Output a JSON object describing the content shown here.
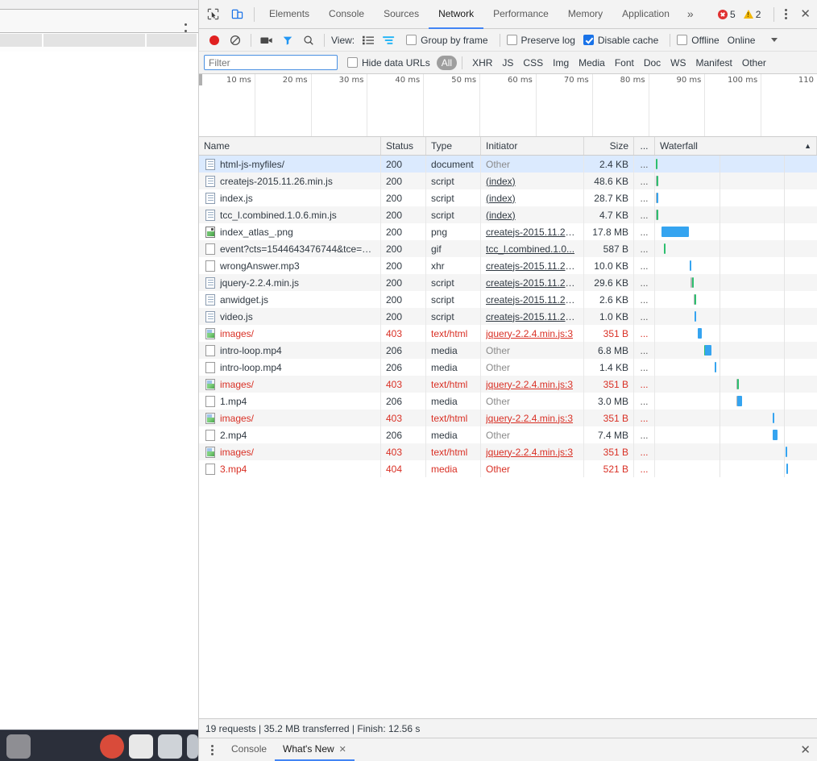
{
  "background_window": {
    "kebab_icon": "kebab-menu-icon",
    "dock_present": true
  },
  "devtools": {
    "tabbar": {
      "inspect_icon": "cursor-inspect-icon",
      "device_toolbar_icon": "device-toolbar-icon",
      "tabs": [
        {
          "label": "Elements",
          "active": false
        },
        {
          "label": "Console",
          "active": false
        },
        {
          "label": "Sources",
          "active": false
        },
        {
          "label": "Network",
          "active": true
        },
        {
          "label": "Performance",
          "active": false
        },
        {
          "label": "Memory",
          "active": false
        },
        {
          "label": "Application",
          "active": false
        }
      ],
      "more_tabs_label": "»",
      "error_count": "5",
      "warning_count": "2",
      "settings_icon": "kebab-menu-icon",
      "close_label": "✕"
    },
    "controlbar": {
      "record_icon": "record-icon",
      "clear_icon": "clear-icon",
      "capture_screenshots_icon": "camera-icon",
      "filter_icon": "funnel-icon",
      "search_icon": "search-icon",
      "view_label": "View:",
      "list_view_icon": "list-view-icon",
      "waterfall_view_icon": "waterfall-view-icon",
      "group_by_frame": {
        "label": "Group by frame",
        "checked": false
      },
      "preserve_log": {
        "label": "Preserve log",
        "checked": false
      },
      "disable_cache": {
        "label": "Disable cache",
        "checked": true
      },
      "offline": {
        "label": "Offline",
        "checked": false
      },
      "throttling_value": "Online",
      "throttling_caret_icon": "chevron-down-icon"
    },
    "filterbar": {
      "filter_placeholder": "Filter",
      "filter_value": "",
      "hide_data_urls": {
        "label": "Hide data URLs",
        "checked": false
      },
      "types": [
        {
          "label": "All",
          "active": true
        },
        {
          "label": "XHR",
          "active": false
        },
        {
          "label": "JS",
          "active": false
        },
        {
          "label": "CSS",
          "active": false
        },
        {
          "label": "Img",
          "active": false
        },
        {
          "label": "Media",
          "active": false
        },
        {
          "label": "Font",
          "active": false
        },
        {
          "label": "Doc",
          "active": false
        },
        {
          "label": "WS",
          "active": false
        },
        {
          "label": "Manifest",
          "active": false
        },
        {
          "label": "Other",
          "active": false
        }
      ]
    },
    "overview_ruler": {
      "ticks": [
        "10 ms",
        "20 ms",
        "30 ms",
        "40 ms",
        "50 ms",
        "60 ms",
        "70 ms",
        "80 ms",
        "90 ms",
        "100 ms",
        "110 "
      ]
    },
    "table": {
      "columns": [
        {
          "label": "Name"
        },
        {
          "label": "Status"
        },
        {
          "label": "Type"
        },
        {
          "label": "Initiator"
        },
        {
          "label": "Size"
        },
        {
          "label": "..."
        },
        {
          "label": "Waterfall"
        }
      ],
      "sort_indicator": "▲",
      "rows": [
        {
          "icon": "document-file-icon",
          "name": "html-js-myfiles/",
          "status": "200",
          "type": "document",
          "initiator": "Other",
          "initiator_link": false,
          "size": "2.4 KB",
          "dots": "...",
          "error": false,
          "selected": true,
          "bars": [
            {
              "kind": "wait",
              "start": 0.5,
              "width": 0.6
            }
          ]
        },
        {
          "icon": "document-file-icon",
          "name": "createjs-2015.11.26.min.js",
          "status": "200",
          "type": "script",
          "initiator": "(index)",
          "initiator_link": true,
          "size": "48.6 KB",
          "dots": "...",
          "error": false,
          "selected": false,
          "bars": [
            {
              "kind": "queue",
              "start": 1.4,
              "width": 0.9
            },
            {
              "kind": "wait",
              "start": 2.2,
              "width": 0.8
            }
          ]
        },
        {
          "icon": "document-file-icon",
          "name": "index.js",
          "status": "200",
          "type": "script",
          "initiator": "(index)",
          "initiator_link": true,
          "size": "28.7 KB",
          "dots": "...",
          "error": false,
          "selected": false,
          "bars": [
            {
              "kind": "queue",
              "start": 1.2,
              "width": 1.0
            },
            {
              "kind": "dl",
              "start": 2.2,
              "width": 0.9
            }
          ]
        },
        {
          "icon": "document-file-icon",
          "name": "tcc_l.combined.1.0.6.min.js",
          "status": "200",
          "type": "script",
          "initiator": "(index)",
          "initiator_link": true,
          "size": "4.7 KB",
          "dots": "...",
          "error": false,
          "selected": false,
          "bars": [
            {
              "kind": "queue",
              "start": 1.3,
              "width": 0.9
            },
            {
              "kind": "wait",
              "start": 2.2,
              "width": 0.9
            }
          ]
        },
        {
          "icon": "image-file-icon",
          "name": "index_atlas_.png",
          "status": "200",
          "type": "png",
          "initiator": "createjs-2015.11.26...",
          "initiator_link": true,
          "size": "17.8 MB",
          "dots": "...",
          "error": false,
          "selected": false,
          "bars": [
            {
              "kind": "dl",
              "start": 8.5,
              "width": 34.0
            }
          ]
        },
        {
          "icon": "blank-file-icon",
          "name": "event?cts=1544643476744&tce=1…",
          "status": "200",
          "type": "gif",
          "initiator": "tcc_l.combined.1.0...",
          "initiator_link": true,
          "size": "587 B",
          "dots": "...",
          "error": false,
          "selected": false,
          "bars": [
            {
              "kind": "wait",
              "start": 11.0,
              "width": 0.8
            }
          ]
        },
        {
          "icon": "blank-file-icon",
          "name": "wrongAnswer.mp3",
          "status": "200",
          "type": "xhr",
          "initiator": "createjs-2015.11.26...",
          "initiator_link": true,
          "size": "10.0 KB",
          "dots": "...",
          "error": false,
          "selected": false,
          "bars": [
            {
              "kind": "dl",
              "start": 43.0,
              "width": 1.0
            }
          ]
        },
        {
          "icon": "document-file-icon",
          "name": "jquery-2.2.4.min.js",
          "status": "200",
          "type": "script",
          "initiator": "createjs-2015.11.26...",
          "initiator_link": true,
          "size": "29.6 KB",
          "dots": "...",
          "error": false,
          "selected": false,
          "bars": [
            {
              "kind": "queue",
              "start": 44.5,
              "width": 1.3
            },
            {
              "kind": "wait",
              "start": 45.8,
              "width": 1.0
            }
          ]
        },
        {
          "icon": "document-file-icon",
          "name": "anwidget.js",
          "status": "200",
          "type": "script",
          "initiator": "createjs-2015.11.26...",
          "initiator_link": true,
          "size": "2.6 KB",
          "dots": "...",
          "error": false,
          "selected": false,
          "bars": [
            {
              "kind": "queue",
              "start": 48.5,
              "width": 0.7
            },
            {
              "kind": "wait",
              "start": 49.0,
              "width": 1.0
            }
          ]
        },
        {
          "icon": "document-file-icon",
          "name": "video.js",
          "status": "200",
          "type": "script",
          "initiator": "createjs-2015.11.26...",
          "initiator_link": true,
          "size": "1.0 KB",
          "dots": "...",
          "error": false,
          "selected": false,
          "bars": [
            {
              "kind": "dl",
              "start": 49.5,
              "width": 0.9
            }
          ]
        },
        {
          "icon": "image-error-icon",
          "name": "images/",
          "status": "403",
          "type": "text/html",
          "initiator": "jquery-2.2.4.min.js:3",
          "initiator_link": true,
          "size": "351 B",
          "dots": "...",
          "error": true,
          "selected": false,
          "bars": [
            {
              "kind": "dl",
              "start": 53.5,
              "width": 5.0
            }
          ]
        },
        {
          "icon": "blank-file-icon",
          "name": "intro-loop.mp4",
          "status": "206",
          "type": "media",
          "initiator": "Other",
          "initiator_link": false,
          "size": "6.8 MB",
          "dots": "...",
          "error": false,
          "selected": false,
          "bars": [
            {
              "kind": "wait",
              "start": 61.5,
              "width": 0.8
            },
            {
              "kind": "dl",
              "start": 62.3,
              "width": 8.0
            }
          ]
        },
        {
          "icon": "blank-file-icon",
          "name": "intro-loop.mp4",
          "status": "206",
          "type": "media",
          "initiator": "Other",
          "initiator_link": false,
          "size": "1.4 KB",
          "dots": "...",
          "error": false,
          "selected": false,
          "bars": [
            {
              "kind": "queue",
              "start": 74.0,
              "width": 0.7
            },
            {
              "kind": "dl",
              "start": 74.5,
              "width": 1.0
            }
          ]
        },
        {
          "icon": "image-error-icon",
          "name": "images/",
          "status": "403",
          "type": "text/html",
          "initiator": "jquery-2.2.4.min.js:3",
          "initiator_link": true,
          "size": "351 B",
          "dots": "...",
          "error": true,
          "selected": false,
          "bars": [
            {
              "kind": "queue",
              "start": 102.0,
              "width": 0.7
            },
            {
              "kind": "wait",
              "start": 102.5,
              "width": 0.8
            }
          ]
        },
        {
          "icon": "blank-file-icon",
          "name": "1.mp4",
          "status": "206",
          "type": "media",
          "initiator": "Other",
          "initiator_link": false,
          "size": "3.0 MB",
          "dots": "...",
          "error": false,
          "selected": false,
          "bars": [
            {
              "kind": "queue",
              "start": 102.0,
              "width": 0.8
            },
            {
              "kind": "dl",
              "start": 103.0,
              "width": 5.5
            }
          ]
        },
        {
          "icon": "image-error-icon",
          "name": "images/",
          "status": "403",
          "type": "text/html",
          "initiator": "jquery-2.2.4.min.js:3",
          "initiator_link": true,
          "size": "351 B",
          "dots": "...",
          "error": true,
          "selected": false,
          "bars": [
            {
              "kind": "dl",
              "start": 147.0,
              "width": 0.9
            }
          ]
        },
        {
          "icon": "blank-file-icon",
          "name": "2.mp4",
          "status": "206",
          "type": "media",
          "initiator": "Other",
          "initiator_link": false,
          "size": "7.4 MB",
          "dots": "...",
          "error": false,
          "selected": false,
          "bars": [
            {
              "kind": "dl",
              "start": 146.5,
              "width": 6.0
            }
          ]
        },
        {
          "icon": "image-error-icon",
          "name": "images/",
          "status": "403",
          "type": "text/html",
          "initiator": "jquery-2.2.4.min.js:3",
          "initiator_link": true,
          "size": "351 B",
          "dots": "...",
          "error": true,
          "selected": false,
          "bars": [
            {
              "kind": "dl",
              "start": 163.0,
              "width": 0.9
            }
          ]
        },
        {
          "icon": "blank-file-icon",
          "name": "3.mp4",
          "status": "404",
          "type": "media",
          "initiator": "Other",
          "initiator_link": false,
          "size": "521 B",
          "dots": "...",
          "error": true,
          "selected": false,
          "bars": [
            {
              "kind": "dl",
              "start": 163.5,
              "width": 0.9
            }
          ]
        }
      ]
    },
    "statusbar": {
      "text": "19 requests | 35.2 MB transferred | Finish: 12.56 s"
    },
    "drawer": {
      "menu_icon": "kebab-menu-icon",
      "tabs": [
        {
          "label": "Console",
          "active": false,
          "closable": false
        },
        {
          "label": "What's New",
          "active": true,
          "closable": true
        }
      ],
      "close_label": "✕"
    }
  },
  "colors": {
    "accent": "#4285f4",
    "error": "#d93025",
    "warning": "#f2b705",
    "selected_row": "#dbeafe",
    "bar_download": "#35a4f0",
    "bar_wait": "#2dbf6f",
    "bar_queue": "#b7b7b7"
  }
}
